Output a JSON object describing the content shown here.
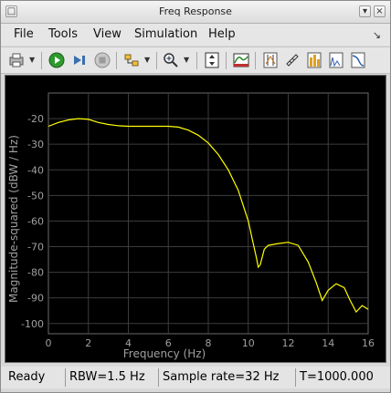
{
  "window": {
    "title": "Freq Response"
  },
  "menu": [
    "File",
    "Tools",
    "View",
    "Simulation",
    "Help"
  ],
  "toolbar": {
    "icons": [
      "print-icon",
      "run-icon",
      "step-forward-icon",
      "stop-icon",
      "highlight-block-icon",
      "zoom-icon",
      "autoscale-icon",
      "spectrum-settings-icon",
      "cursor-icon",
      "ruler-icon",
      "peak-finder-icon",
      "distortion-icon",
      "ccdf-icon"
    ]
  },
  "status": {
    "state": "Ready",
    "rbw": "RBW=1.5 Hz",
    "sample_rate": "Sample rate=32 Hz",
    "time": "T=1000.000"
  },
  "colors": {
    "plot_bg": "#000000",
    "trace": "#ffff00",
    "grid": "#404040",
    "axis_text": "#a0a0a0"
  },
  "chart_data": {
    "type": "line",
    "xlabel": "Frequency (Hz)",
    "ylabel": "Magnitude-squared (dBW / Hz)",
    "xlim": [
      0,
      16
    ],
    "ylim": [
      -104,
      -10
    ],
    "xticks": [
      "0",
      "2",
      "4",
      "6",
      "8",
      "10",
      "12",
      "14",
      "16"
    ],
    "yticks": [
      "-20",
      "-30",
      "-40",
      "-50",
      "-60",
      "-70",
      "-80",
      "-90",
      "-100"
    ],
    "grid": true,
    "series": [
      {
        "x": [
          0,
          0.5,
          1.0,
          1.5,
          2.0,
          2.5,
          3.0,
          3.5,
          4.0,
          4.5,
          5.0,
          5.5,
          6.0,
          6.5,
          7.0,
          7.5,
          8.0,
          8.5,
          9.0,
          9.5,
          10.0,
          10.2,
          10.4,
          10.5,
          10.6,
          10.8,
          11.0,
          11.5,
          12.0,
          12.5,
          13.0,
          13.4,
          13.7,
          14.0,
          14.4,
          14.8,
          15.1,
          15.4,
          15.7,
          16.0
        ],
        "y": [
          -23,
          -21.5,
          -20.5,
          -20,
          -20.3,
          -21.5,
          -22.3,
          -22.8,
          -23,
          -23,
          -23,
          -23,
          -23,
          -23.3,
          -24.5,
          -26.5,
          -29.5,
          -34,
          -40,
          -48,
          -60,
          -67,
          -74,
          -78,
          -77,
          -71,
          -69.5,
          -68.8,
          -68.3,
          -69.5,
          -76,
          -84,
          -91,
          -87,
          -84.5,
          -86,
          -91,
          -95.5,
          -93,
          -94.5
        ]
      }
    ]
  }
}
